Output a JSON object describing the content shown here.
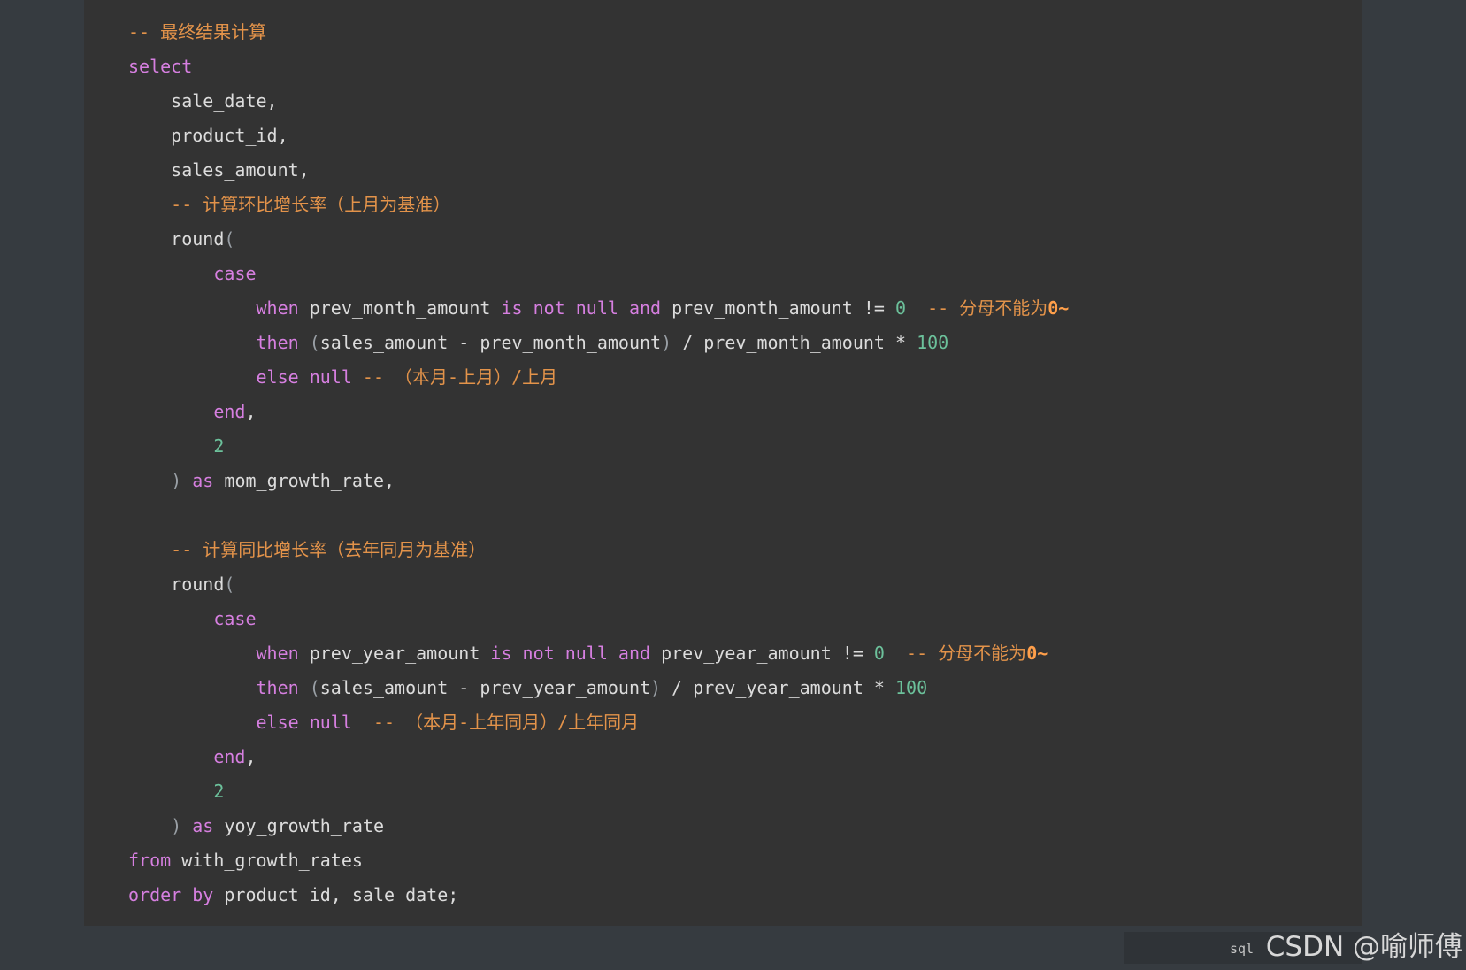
{
  "code": {
    "lines": [
      [
        {
          "t": "-- 最终结果计算",
          "c": "comment"
        }
      ],
      [
        {
          "t": "select",
          "c": "keyword"
        }
      ],
      [
        {
          "t": "    sale_date,",
          "c": "ident"
        }
      ],
      [
        {
          "t": "    product_id,",
          "c": "ident"
        }
      ],
      [
        {
          "t": "    sales_amount,",
          "c": "ident"
        }
      ],
      [
        {
          "t": "    -- 计算环比增长率（上月为基准）",
          "c": "comment"
        }
      ],
      [
        {
          "t": "    round",
          "c": "ident"
        },
        {
          "t": "(",
          "c": "paren"
        }
      ],
      [
        {
          "t": "        ",
          "c": "ident"
        },
        {
          "t": "case",
          "c": "keyword"
        }
      ],
      [
        {
          "t": "            ",
          "c": "ident"
        },
        {
          "t": "when",
          "c": "keyword"
        },
        {
          "t": " prev_month_amount ",
          "c": "ident"
        },
        {
          "t": "is not null and",
          "c": "keyword"
        },
        {
          "t": " prev_month_amount != ",
          "c": "ident"
        },
        {
          "t": "0",
          "c": "number"
        },
        {
          "t": "  -- 分母不能为",
          "c": "comment"
        },
        {
          "t": "0~",
          "c": "comment-strong"
        }
      ],
      [
        {
          "t": "            ",
          "c": "ident"
        },
        {
          "t": "then",
          "c": "keyword"
        },
        {
          "t": " ",
          "c": "ident"
        },
        {
          "t": "(",
          "c": "paren"
        },
        {
          "t": "sales_amount - prev_month_amount",
          "c": "ident"
        },
        {
          "t": ")",
          "c": "paren"
        },
        {
          "t": " / prev_month_amount * ",
          "c": "ident"
        },
        {
          "t": "100",
          "c": "number"
        }
      ],
      [
        {
          "t": "            ",
          "c": "ident"
        },
        {
          "t": "else",
          "c": "keyword"
        },
        {
          "t": " ",
          "c": "ident"
        },
        {
          "t": "null",
          "c": "keyword"
        },
        {
          "t": " -- （本月-上月）/上月",
          "c": "comment"
        }
      ],
      [
        {
          "t": "        ",
          "c": "ident"
        },
        {
          "t": "end",
          "c": "keyword"
        },
        {
          "t": ",",
          "c": "ident"
        }
      ],
      [
        {
          "t": "        ",
          "c": "ident"
        },
        {
          "t": "2",
          "c": "number"
        }
      ],
      [
        {
          "t": "    ",
          "c": "ident"
        },
        {
          "t": ")",
          "c": "paren"
        },
        {
          "t": " ",
          "c": "ident"
        },
        {
          "t": "as",
          "c": "keyword"
        },
        {
          "t": " mom_growth_rate,",
          "c": "ident"
        }
      ],
      [
        {
          "t": "",
          "c": "ident"
        }
      ],
      [
        {
          "t": "    -- 计算同比增长率（去年同月为基准）",
          "c": "comment"
        }
      ],
      [
        {
          "t": "    round",
          "c": "ident"
        },
        {
          "t": "(",
          "c": "paren"
        }
      ],
      [
        {
          "t": "        ",
          "c": "ident"
        },
        {
          "t": "case",
          "c": "keyword"
        }
      ],
      [
        {
          "t": "            ",
          "c": "ident"
        },
        {
          "t": "when",
          "c": "keyword"
        },
        {
          "t": " prev_year_amount ",
          "c": "ident"
        },
        {
          "t": "is not null and",
          "c": "keyword"
        },
        {
          "t": " prev_year_amount != ",
          "c": "ident"
        },
        {
          "t": "0",
          "c": "number"
        },
        {
          "t": "  -- 分母不能为",
          "c": "comment"
        },
        {
          "t": "0~",
          "c": "comment-strong"
        }
      ],
      [
        {
          "t": "            ",
          "c": "ident"
        },
        {
          "t": "then",
          "c": "keyword"
        },
        {
          "t": " ",
          "c": "ident"
        },
        {
          "t": "(",
          "c": "paren"
        },
        {
          "t": "sales_amount - prev_year_amount",
          "c": "ident"
        },
        {
          "t": ")",
          "c": "paren"
        },
        {
          "t": " / prev_year_amount * ",
          "c": "ident"
        },
        {
          "t": "100",
          "c": "number"
        }
      ],
      [
        {
          "t": "            ",
          "c": "ident"
        },
        {
          "t": "else",
          "c": "keyword"
        },
        {
          "t": " ",
          "c": "ident"
        },
        {
          "t": "null",
          "c": "keyword"
        },
        {
          "t": "  -- （本月-上年同月）/上年同月",
          "c": "comment"
        }
      ],
      [
        {
          "t": "        ",
          "c": "ident"
        },
        {
          "t": "end",
          "c": "keyword"
        },
        {
          "t": ",",
          "c": "ident"
        }
      ],
      [
        {
          "t": "        ",
          "c": "ident"
        },
        {
          "t": "2",
          "c": "number"
        }
      ],
      [
        {
          "t": "    ",
          "c": "ident"
        },
        {
          "t": ")",
          "c": "paren"
        },
        {
          "t": " ",
          "c": "ident"
        },
        {
          "t": "as",
          "c": "keyword"
        },
        {
          "t": " yoy_growth_rate",
          "c": "ident"
        }
      ],
      [
        {
          "t": "from",
          "c": "keyword"
        },
        {
          "t": " with_growth_rates",
          "c": "ident"
        }
      ],
      [
        {
          "t": "order by",
          "c": "keyword"
        },
        {
          "t": " product_id, sale_date;",
          "c": "ident"
        }
      ]
    ]
  },
  "language_label": "sql",
  "watermark": "CSDN @喻师傅",
  "colors": {
    "page_background": "#363b40",
    "code_background": "#333333",
    "keyword": "#d67fe0",
    "identifier": "#dcdcdc",
    "number": "#6cc19b",
    "comment": "#e3934a"
  }
}
